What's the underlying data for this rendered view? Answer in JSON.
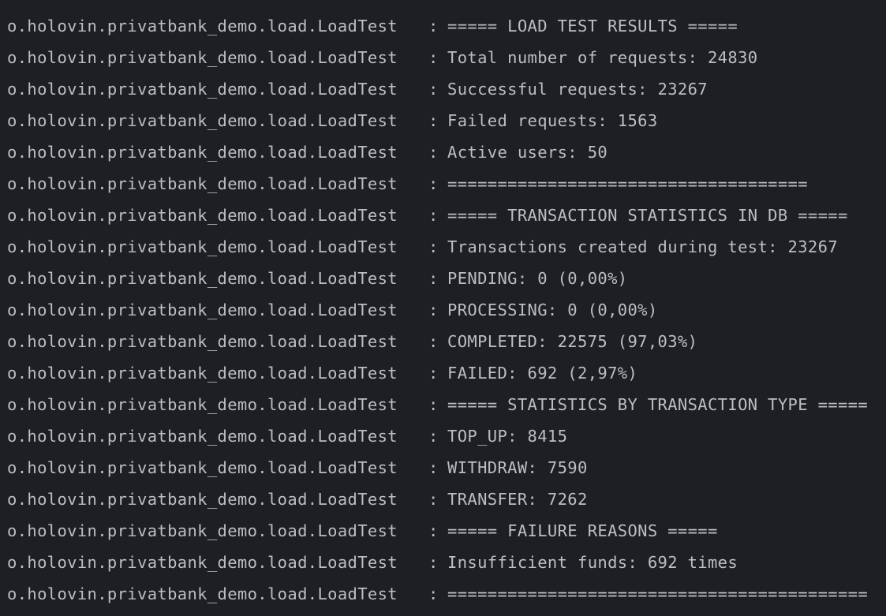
{
  "console": {
    "colors": {
      "background": "#1e1f22",
      "text": "#bcbec4"
    },
    "separator": ":",
    "lines": [
      {
        "logger": "o.holovin.privatbank_demo.load.LoadTest",
        "message": "===== LOAD TEST RESULTS ====="
      },
      {
        "logger": "o.holovin.privatbank_demo.load.LoadTest",
        "message": "Total number of requests: 24830"
      },
      {
        "logger": "o.holovin.privatbank_demo.load.LoadTest",
        "message": "Successful requests: 23267"
      },
      {
        "logger": "o.holovin.privatbank_demo.load.LoadTest",
        "message": "Failed requests: 1563"
      },
      {
        "logger": "o.holovin.privatbank_demo.load.LoadTest",
        "message": "Active users: 50"
      },
      {
        "logger": "o.holovin.privatbank_demo.load.LoadTest",
        "message": "===================================="
      },
      {
        "logger": "o.holovin.privatbank_demo.load.LoadTest",
        "message": "===== TRANSACTION STATISTICS IN DB ====="
      },
      {
        "logger": "o.holovin.privatbank_demo.load.LoadTest",
        "message": "Transactions created during test: 23267"
      },
      {
        "logger": "o.holovin.privatbank_demo.load.LoadTest",
        "message": "PENDING: 0 (0,00%)"
      },
      {
        "logger": "o.holovin.privatbank_demo.load.LoadTest",
        "message": "PROCESSING: 0 (0,00%)"
      },
      {
        "logger": "o.holovin.privatbank_demo.load.LoadTest",
        "message": "COMPLETED: 22575 (97,03%)"
      },
      {
        "logger": "o.holovin.privatbank_demo.load.LoadTest",
        "message": "FAILED: 692 (2,97%)"
      },
      {
        "logger": "o.holovin.privatbank_demo.load.LoadTest",
        "message": "===== STATISTICS BY TRANSACTION TYPE ====="
      },
      {
        "logger": "o.holovin.privatbank_demo.load.LoadTest",
        "message": "TOP_UP: 8415"
      },
      {
        "logger": "o.holovin.privatbank_demo.load.LoadTest",
        "message": "WITHDRAW: 7590"
      },
      {
        "logger": "o.holovin.privatbank_demo.load.LoadTest",
        "message": "TRANSFER: 7262"
      },
      {
        "logger": "o.holovin.privatbank_demo.load.LoadTest",
        "message": "===== FAILURE REASONS ====="
      },
      {
        "logger": "o.holovin.privatbank_demo.load.LoadTest",
        "message": "Insufficient funds: 692 times"
      },
      {
        "logger": "o.holovin.privatbank_demo.load.LoadTest",
        "message": "=========================================="
      }
    ]
  }
}
